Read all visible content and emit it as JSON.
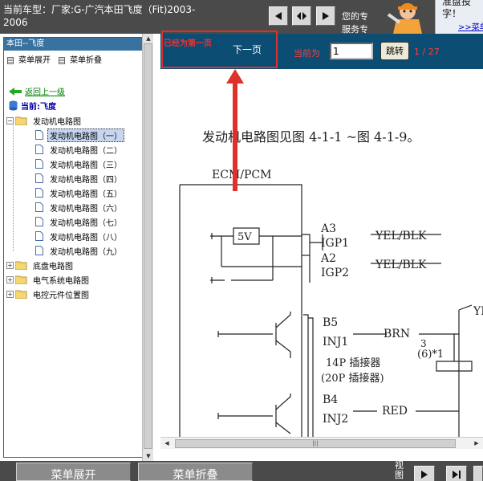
{
  "header": {
    "vehicle_line1": "当前车型：厂家:G-广汽本田飞度（Fit)2003-",
    "vehicle_line2": "2006",
    "service_line1": "您的专",
    "service_line2": "服务专",
    "ad_text_line1": "准盘投",
    "ad_text_line2": "字！",
    "ad_link": ">>菜单"
  },
  "sidebar": {
    "title": "本田--飞度",
    "expand_label": "菜单展开",
    "collapse_label": "菜单折叠",
    "back_label": "返回上一级",
    "current_label": "当前:飞度",
    "tree": {
      "root_label": "发动机电路图",
      "children": [
        "发动机电路图（一）",
        "发动机电路图（二）",
        "发动机电路图（三）",
        "发动机电路图（四）",
        "发动机电路图（五）",
        "发动机电路图（六）",
        "发动机电路图（七）",
        "发动机电路图（八）",
        "发动机电路图（九）"
      ],
      "selected_index": 0,
      "other_roots": [
        "底盘电路图",
        "电气系统电路图",
        "电控元件位置图"
      ]
    }
  },
  "pager": {
    "prev_label": "已经为第一页",
    "next_label": "下一页",
    "current_label": "当前为",
    "page_value": "1",
    "go_label": "跳转",
    "page_count": "1 / 27"
  },
  "diagram": {
    "heading": "发动机电路图见图 4-1-1 ~图 4-1-9。",
    "ecm_label": "ECM/PCM",
    "v_label": "5V",
    "pins": [
      {
        "pin": "A3",
        "name": "IGP1",
        "wire": "YEL/BLK"
      },
      {
        "pin": "A2",
        "name": "IGP2",
        "wire": "YEL/BLK"
      },
      {
        "pin": "B5",
        "name": "INJ1",
        "wire": "BRN"
      },
      {
        "pin": "B4",
        "name": "INJ2",
        "wire": "RED"
      }
    ],
    "connector_line1": "14P 插接器",
    "connector_line2": "(20P 插接器)",
    "n3": "3",
    "n6": "(6)*1",
    "yl": "YE"
  },
  "footer": {
    "expand_button": "菜单展开",
    "collapse_button": "菜单折叠",
    "view_label": "视图"
  },
  "colors": {
    "topbar": "#4a4a4a",
    "pagebar": "#0c4d74",
    "annotation": "#e0302a",
    "sidebar_title": "#39729f"
  }
}
